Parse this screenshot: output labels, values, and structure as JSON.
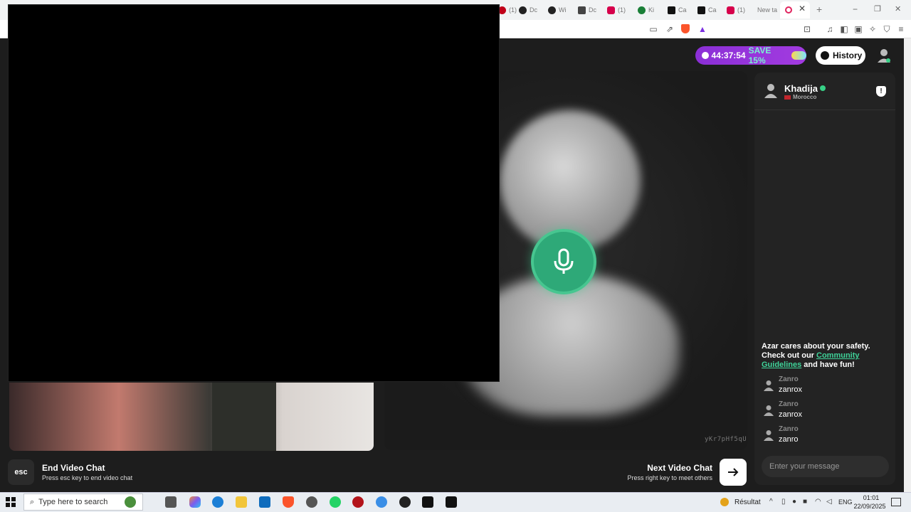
{
  "browser": {
    "tabs": [
      {
        "label": "(1)",
        "color": "#c00018"
      },
      {
        "label": "Dc",
        "color": "#222222"
      },
      {
        "label": "Wi",
        "color": "#222222"
      },
      {
        "label": "Dc",
        "color": "#444444"
      },
      {
        "label": "(1)",
        "color": "#d6004b"
      },
      {
        "label": "Ki",
        "color": "#1a7f37"
      },
      {
        "label": "Ca",
        "color": "#111111"
      },
      {
        "label": "Ca",
        "color": "#111111"
      },
      {
        "label": "(1)",
        "color": "#d6004b"
      },
      {
        "label": "New ta",
        "color": "#888888"
      }
    ],
    "active_tab_icon": "record-icon",
    "new_tab_symbol": "+",
    "window_controls": [
      "−",
      "❐",
      "✕"
    ]
  },
  "header": {
    "timer": "44:37:54",
    "save_label": "SAVE 15%",
    "history_label": "History"
  },
  "partner": {
    "name": "Khadija",
    "country": "Morocco",
    "flag_color": "#c1272d"
  },
  "video": {
    "id_text": "yKr7pHf5qU"
  },
  "chat": {
    "safety_line1": "Azar cares about your safety. Check out our ",
    "safety_link": "Community Guidelines",
    "safety_line2": " and have fun!",
    "messages": [
      {
        "sender": "Zanro",
        "text": "zanrox"
      },
      {
        "sender": "Zanro",
        "text": "zanrox"
      },
      {
        "sender": "Zanro",
        "text": "zanro"
      }
    ],
    "input_placeholder": "Enter your message"
  },
  "controls": {
    "esc_label": "esc",
    "end_title": "End Video Chat",
    "end_sub": "Press esc key to end video chat",
    "next_title": "Next Video Chat",
    "next_sub": "Press right key to meet others"
  },
  "taskbar": {
    "search_placeholder": "Type here to search",
    "weather": "Résultat",
    "lang": "ENG",
    "time": "01:01",
    "date": "22/09/2025",
    "icons": [
      "task-view-icon",
      "copilot-icon",
      "edge-icon",
      "file-explorer-icon",
      "outlook-icon",
      "brave-icon",
      "settings-icon",
      "whatsapp-icon",
      "app-icon",
      "network-icon",
      "obs-icon",
      "capcut-icon",
      "capcut-icon"
    ]
  },
  "colors": {
    "accent_green": "#2ea978",
    "timer_purple": "#8b2fd6",
    "link_green": "#3fd49a"
  }
}
